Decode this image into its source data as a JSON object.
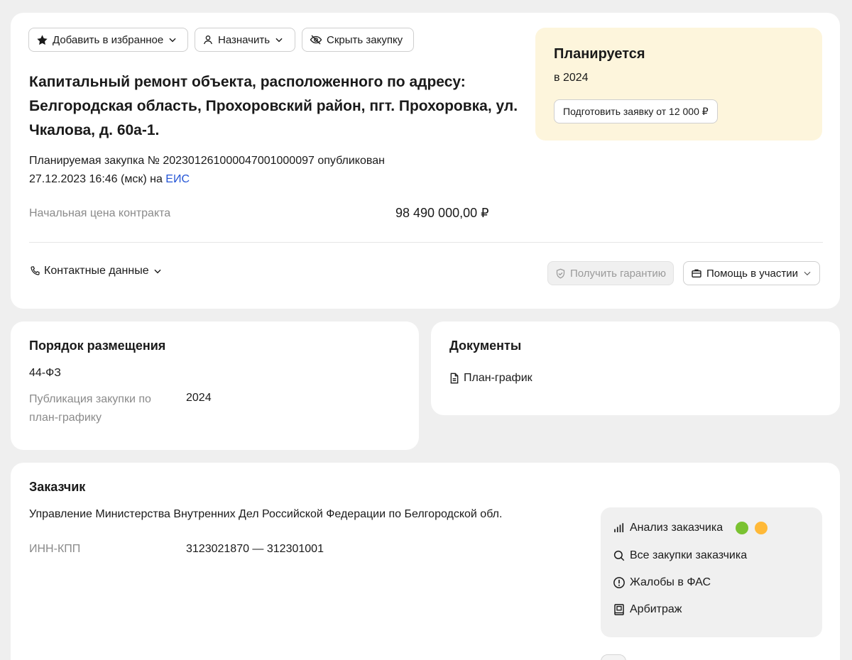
{
  "toolbar": {
    "favorite_label": "Добавить в избранное",
    "assign_label": "Назначить",
    "hide_label": "Скрыть закупку"
  },
  "purchase": {
    "title": "Капитальный ремонт объекта, расположенного по адресу: Белгородская область, Прохоровский район, пгт. Прохоровка, ул. Чкалова, д. 60а-1.",
    "meta_prefix": "Планируемая закупка № 202301261000047001000097 опубликован 27.12.2023 16:46 (мск) на ",
    "meta_link": "ЕИС",
    "price_label": "Начальная цена контракта",
    "price_value": "98 490 000,00 ₽",
    "contacts_label": "Контактные данные"
  },
  "status": {
    "title": "Планируется",
    "year": "в 2024",
    "prepare_button": "Подготовить заявку от 12 000 ₽"
  },
  "actions": {
    "guarantee_label": "Получить гарантию",
    "help_label": "Помощь в участии"
  },
  "order": {
    "title": "Порядок размещения",
    "law": "44-ФЗ",
    "publication_label": "Публикация закупки по план-графику",
    "publication_value": "2024"
  },
  "documents": {
    "title": "Документы",
    "items": [
      "План-график"
    ]
  },
  "customer": {
    "title": "Заказчик",
    "name": "Управление Министерства Внутренних Дел Российской Федерации по Белгородской обл.",
    "inn_label": "ИНН-КПП",
    "inn_value": "3123021870 — 312301001",
    "tools": [
      {
        "label": "Анализ заказчика",
        "icon": "bar-chart-icon"
      },
      {
        "label": "Все закупки заказчика",
        "icon": "search-icon"
      },
      {
        "label": "Жалобы в ФАС",
        "icon": "alert-circle-icon"
      },
      {
        "label": "Арбитраж",
        "icon": "book-icon"
      }
    ],
    "rating_colors": [
      "#7ac231",
      "#ffb938"
    ]
  }
}
